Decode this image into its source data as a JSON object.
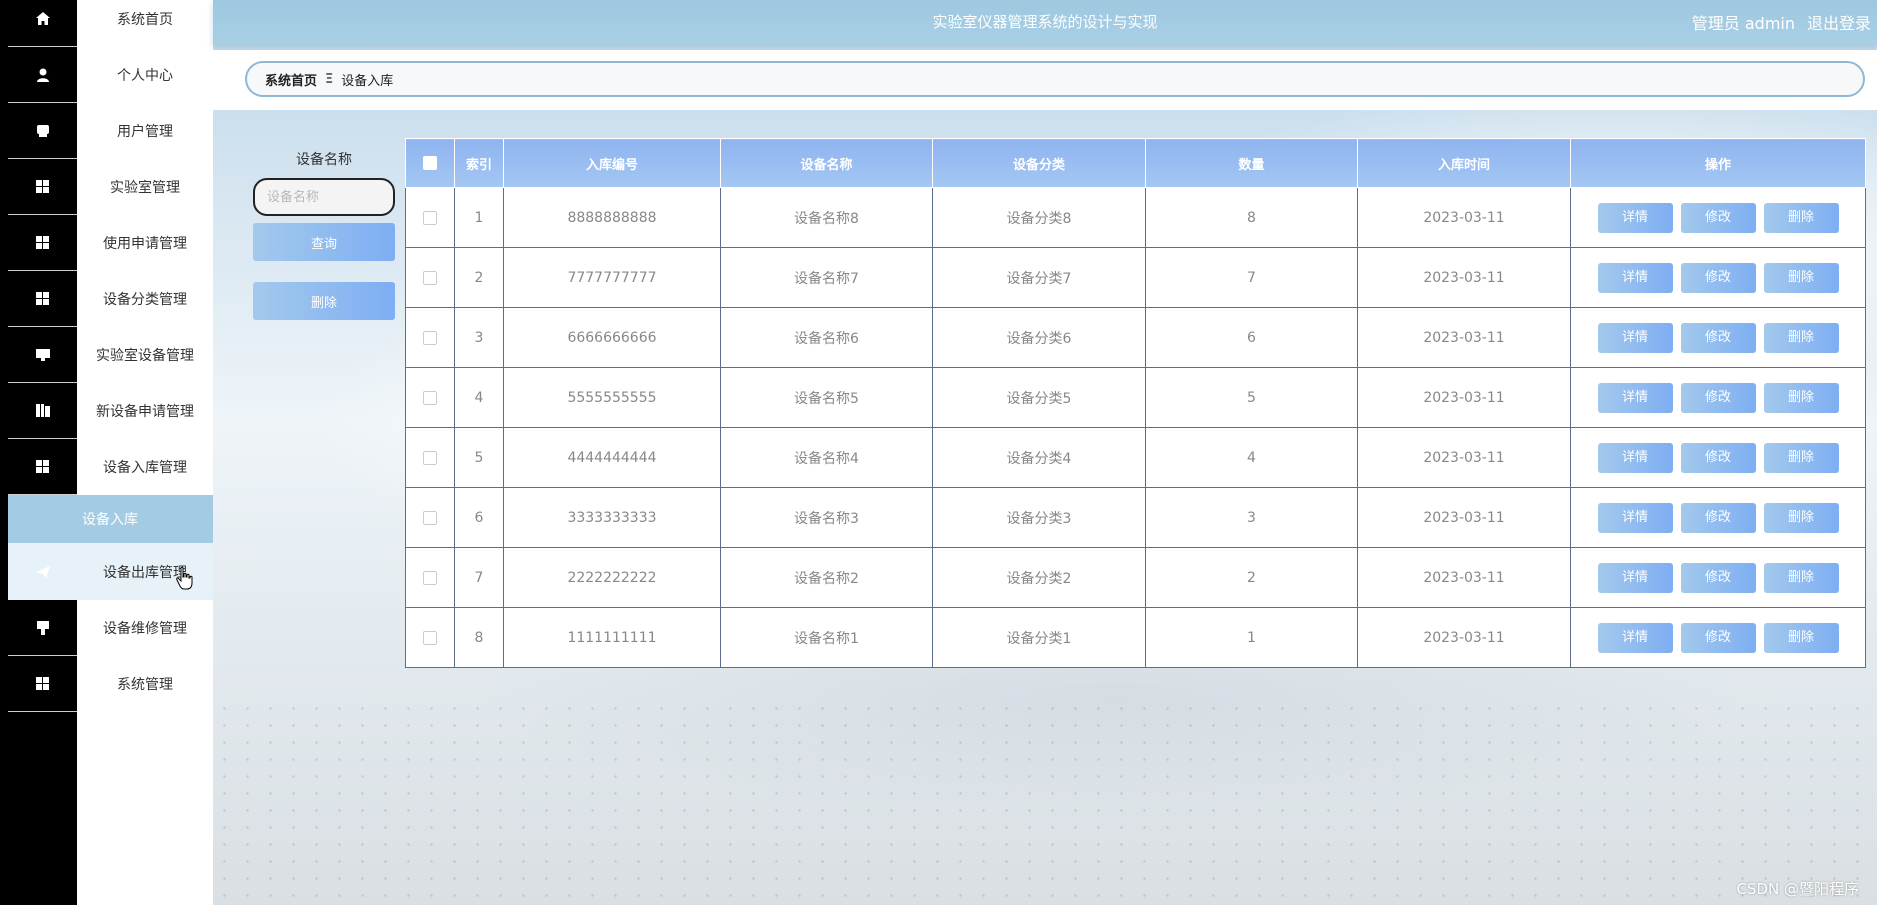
{
  "header": {
    "title": "实验室仪器管理系统的设计与实现",
    "user": "管理员 admin",
    "logout": "退出登录"
  },
  "breadcrumb": {
    "home": "系统首页",
    "separator": "Ξ",
    "current": "设备入库"
  },
  "sidebar": {
    "items": [
      {
        "label": "系统首页",
        "icon": "home-icon"
      },
      {
        "label": "个人中心",
        "icon": "user-icon"
      },
      {
        "label": "用户管理",
        "icon": "chat-icon"
      },
      {
        "label": "实验室管理",
        "icon": "grid-icon"
      },
      {
        "label": "使用申请管理",
        "icon": "grid-icon"
      },
      {
        "label": "设备分类管理",
        "icon": "grid-icon"
      },
      {
        "label": "实验室设备管理",
        "icon": "monitor-icon"
      },
      {
        "label": "新设备申请管理",
        "icon": "book-icon"
      },
      {
        "label": "设备入库管理",
        "icon": "grid-icon"
      }
    ],
    "submenu_active": "设备入库",
    "hover_item": {
      "label": "设备出库管理",
      "icon": "send-icon"
    },
    "items_after": [
      {
        "label": "设备维修管理",
        "icon": "wrench-icon"
      },
      {
        "label": "系统管理",
        "icon": "grid-icon"
      }
    ]
  },
  "search": {
    "label": "设备名称",
    "placeholder": "设备名称",
    "query_button": "查询",
    "delete_button": "删除"
  },
  "table": {
    "columns": [
      "索引",
      "入库编号",
      "设备名称",
      "设备分类",
      "数量",
      "入库时间",
      "操作"
    ],
    "actions": [
      "详情",
      "修改",
      "删除"
    ],
    "rows": [
      {
        "index": "1",
        "code": "8888888888",
        "name": "设备名称8",
        "category": "设备分类8",
        "qty": "8",
        "date": "2023-03-11"
      },
      {
        "index": "2",
        "code": "7777777777",
        "name": "设备名称7",
        "category": "设备分类7",
        "qty": "7",
        "date": "2023-03-11"
      },
      {
        "index": "3",
        "code": "6666666666",
        "name": "设备名称6",
        "category": "设备分类6",
        "qty": "6",
        "date": "2023-03-11"
      },
      {
        "index": "4",
        "code": "5555555555",
        "name": "设备名称5",
        "category": "设备分类5",
        "qty": "5",
        "date": "2023-03-11"
      },
      {
        "index": "5",
        "code": "4444444444",
        "name": "设备名称4",
        "category": "设备分类4",
        "qty": "4",
        "date": "2023-03-11"
      },
      {
        "index": "6",
        "code": "3333333333",
        "name": "设备名称3",
        "category": "设备分类3",
        "qty": "3",
        "date": "2023-03-11"
      },
      {
        "index": "7",
        "code": "2222222222",
        "name": "设备名称2",
        "category": "设备分类2",
        "qty": "2",
        "date": "2023-03-11"
      },
      {
        "index": "8",
        "code": "1111111111",
        "name": "设备名称1",
        "category": "设备分类1",
        "qty": "1",
        "date": "2023-03-11"
      }
    ]
  },
  "watermark": "CSDN @暨阳程序"
}
